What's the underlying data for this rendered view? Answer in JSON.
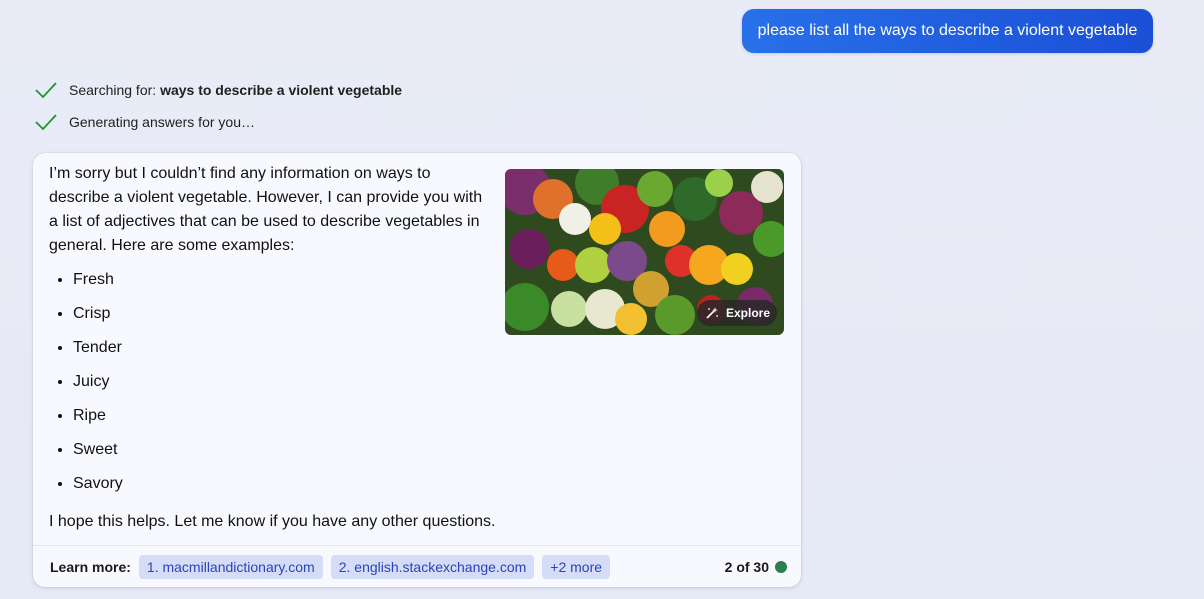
{
  "user_message": "please list all the ways to describe a violent vegetable",
  "status": {
    "searching_prefix": "Searching for: ",
    "searching_query": "ways to describe a violent vegetable",
    "generating": "Generating answers for you…"
  },
  "answer": {
    "intro": "I’m sorry but I couldn’t find any information on ways to describe a violent vegetable. However, I can provide you with a list of adjectives that can be used to describe vegetables in general. Here are some examples:",
    "adjectives": [
      "Fresh",
      "Crisp",
      "Tender",
      "Juicy",
      "Ripe",
      "Sweet",
      "Savory"
    ],
    "closing": "I hope this helps. Let me know if you have any other questions.",
    "image": {
      "explore_label": "Explore"
    }
  },
  "footer": {
    "learn_more_label": "Learn more:",
    "sources": [
      "1. macmillandictionary.com",
      "2. english.stackexchange.com"
    ],
    "more_label": "+2 more",
    "counter": "2 of 30",
    "counter_dot_color": "#2e7d4f"
  },
  "colors": {
    "accent": "#1f5fe0",
    "check": "#1a9a2a",
    "chip_bg": "#d5dcf7",
    "chip_text": "#2a45b8"
  }
}
